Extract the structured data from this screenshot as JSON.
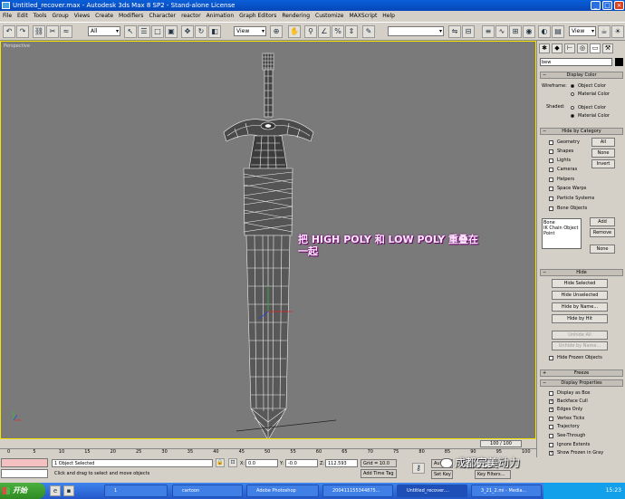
{
  "window": {
    "title": "Untitled_recover.max - Autodesk 3ds Max 8 SP2 - Stand-alone License",
    "buttons": {
      "minimize": "_",
      "maximize": "□",
      "close": "×"
    }
  },
  "menu": [
    "File",
    "Edit",
    "Tools",
    "Group",
    "Views",
    "Create",
    "Modifiers",
    "Character",
    "reactor",
    "Animation",
    "Graph Editors",
    "Rendering",
    "Customize",
    "MAXScript",
    "Help"
  ],
  "toolbar": {
    "selection_filter": "All",
    "ref_coord": "View",
    "named_selection": "",
    "render_view": "View"
  },
  "viewport": {
    "label": "Perspective",
    "overlay_text_line1": "把 HIGH POLY 和 LOW POLY 重叠在",
    "overlay_text_line2": "一起"
  },
  "command_panel": {
    "tabs": [
      "create-icon",
      "modify-icon",
      "hierarchy-icon",
      "motion-icon",
      "display-icon",
      "utilities-icon"
    ],
    "object_name": "bew",
    "object_color": "#000000",
    "display_color": {
      "title": "Display Color",
      "wireframe_label": "Wireframe:",
      "shaded_label": "Shaded:",
      "options": [
        "Object Color",
        "Material Color"
      ],
      "wireframe_selected": "Object Color",
      "shaded_selected": "Material Color"
    },
    "hide_by_category": {
      "title": "Hide by Category",
      "items": [
        "Geometry",
        "Shapes",
        "Lights",
        "Cameras",
        "Helpers",
        "Space Warps",
        "Particle Systems",
        "Bone Objects"
      ],
      "buttons": [
        "All",
        "None",
        "Invert"
      ],
      "list": [
        "Bone",
        "IK Chain Object",
        "Point"
      ],
      "list_buttons": [
        "Add",
        "Remove",
        "None"
      ]
    },
    "hide": {
      "title": "Hide",
      "buttons": [
        "Hide Selected",
        "Hide Unselected",
        "Hide by Name...",
        "Hide by Hit",
        "Unhide All",
        "Unhide by Name..."
      ],
      "checkbox": "Hide Frozen Objects"
    },
    "freeze": {
      "title": "Freeze"
    },
    "display_properties": {
      "title": "Display Properties",
      "items": [
        {
          "label": "Display as Box",
          "checked": false
        },
        {
          "label": "Backface Cull",
          "checked": true
        },
        {
          "label": "Edges Only",
          "checked": true
        },
        {
          "label": "Vertex Ticks",
          "checked": false
        },
        {
          "label": "Trajectory",
          "checked": false
        },
        {
          "label": "See-Through",
          "checked": false
        },
        {
          "label": "Ignore Extents",
          "checked": false
        },
        {
          "label": "Show Frozen in Gray",
          "checked": true
        }
      ]
    }
  },
  "timeline": {
    "slider": "100 / 100",
    "ticks": [
      "0",
      "5",
      "10",
      "15",
      "20",
      "25",
      "30",
      "35",
      "40",
      "45",
      "50",
      "55",
      "60",
      "65",
      "70",
      "75",
      "80",
      "85",
      "90",
      "95",
      "100"
    ]
  },
  "status": {
    "selection": "1 Object Selected",
    "prompt": "Click and drag to select and move objects",
    "x_label": "X:",
    "x": "0.0",
    "y_label": "Y:",
    "y": "-0.0",
    "z_label": "Z:",
    "z": "112.593",
    "grid": "Grid = 10.0",
    "add_time_tag": "Add Time Tag",
    "auto_key": "Auto",
    "set_key": "Set Key",
    "selected": "cted",
    "key_filters": "Key Filters..."
  },
  "taskbar": {
    "start": "开始",
    "tasks": [
      "1",
      "cartoon",
      "Adobe Photoshop",
      "200411155344875...",
      "Untitled_recover....",
      "3_21_2.mi - Media..."
    ],
    "clock": "15:23"
  },
  "watermark": "成都完美动力"
}
